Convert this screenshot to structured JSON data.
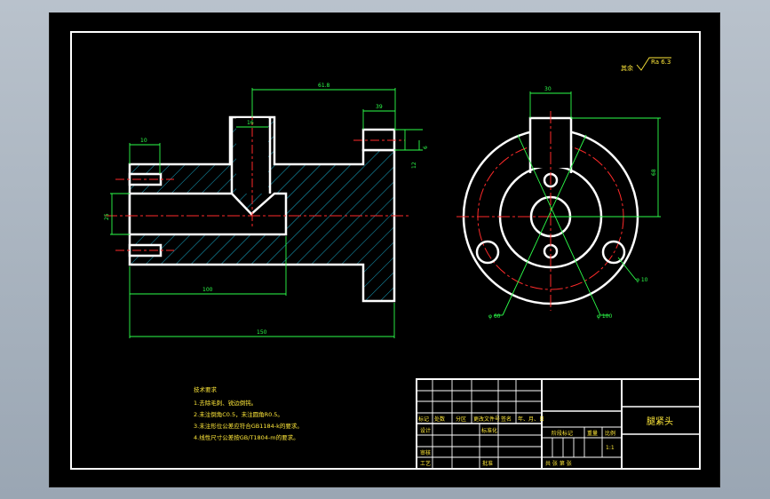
{
  "drawing_title": "腿紧头",
  "roughness": {
    "label": "其余",
    "value": "Ra 6.3"
  },
  "dims": {
    "top_length": "61.8",
    "top_right": "39",
    "slot_top": "16",
    "left_small": "10",
    "left_height": "25",
    "right_h1": "12",
    "right_h2": "6",
    "bottom_inner": "100",
    "bottom_total": "150",
    "side_top": "30",
    "side_height": "68",
    "diam_left": "φ 60",
    "diam_right": "φ 100",
    "hole": "φ 10"
  },
  "tech_notes": {
    "heading": "技术要求",
    "items": [
      "1.去除毛刺、锐边倒钝。",
      "2.未注倒角C0.5，未注圆角R0.5。",
      "3.未注形位公差应符合GB1184-k的要求。",
      "4.线性尺寸公差按GB/T1804-m的要求。"
    ]
  },
  "title_block": {
    "row1": [
      "标记",
      "处数",
      "分区",
      "更改文件号",
      "签名",
      "年、月、日"
    ],
    "design": "设计",
    "standard": "标准化",
    "stage": "阶段标记",
    "weight": "重量",
    "scale": "比例",
    "scale_value": "1:1",
    "review": "审核",
    "process": "工艺",
    "approve": "批准",
    "sheets": "共  张  第  张"
  }
}
